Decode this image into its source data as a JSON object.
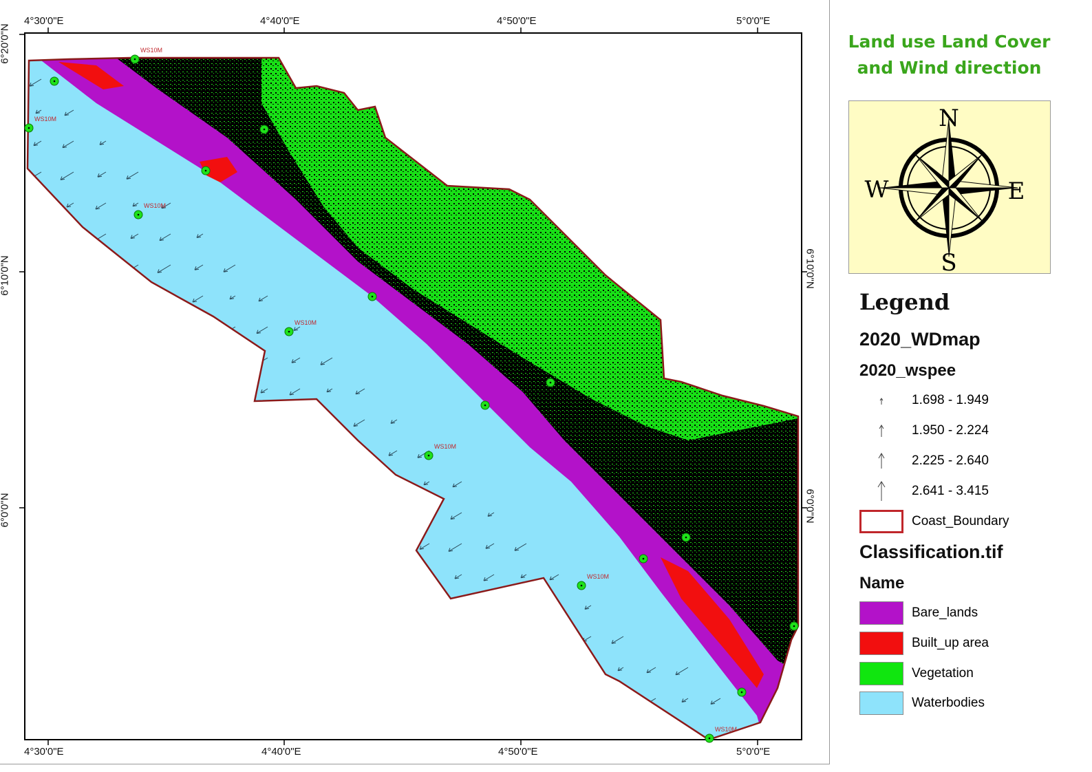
{
  "title": [
    "Land use Land Cover",
    "and Wind direction"
  ],
  "axes": {
    "top": [
      "4°30'0\"E",
      "4°40'0\"E",
      "4°50'0\"E",
      "5°0'0\"E"
    ],
    "bottom": [
      "4°30'0\"E",
      "4°40'0\"E",
      "4°50'0\"E",
      "5°0'0\"E"
    ],
    "left": [
      "6°20'0\"N",
      "6°10'0\"N",
      "6°0'0\"N"
    ],
    "right": [
      "6°10'0\"N",
      "6°0'0\"N"
    ]
  },
  "station_label": "WS10M",
  "compass": {
    "n": "N",
    "e": "E",
    "s": "S",
    "w": "W"
  },
  "legend": {
    "heading": "Legend",
    "layer1": "2020_WDmap",
    "field1": "2020_wspee",
    "wind_classes": [
      {
        "label": "1.698 - 1.949"
      },
      {
        "label": "1.950 - 2.224"
      },
      {
        "label": "2.225 - 2.640"
      },
      {
        "label": "2.641 - 3.415"
      }
    ],
    "boundary": {
      "label": "Coast_Boundary",
      "color": "#c0262b"
    },
    "layer2": "Classification.tif",
    "field2": "Name",
    "classes": [
      {
        "label": "Bare_lands",
        "color": "#b312c9"
      },
      {
        "label": "Built_up area",
        "color": "#f20f0f"
      },
      {
        "label": "Vegetation",
        "color": "#10e60f"
      },
      {
        "label": "Waterbodies",
        "color": "#8ee3fb"
      }
    ]
  }
}
